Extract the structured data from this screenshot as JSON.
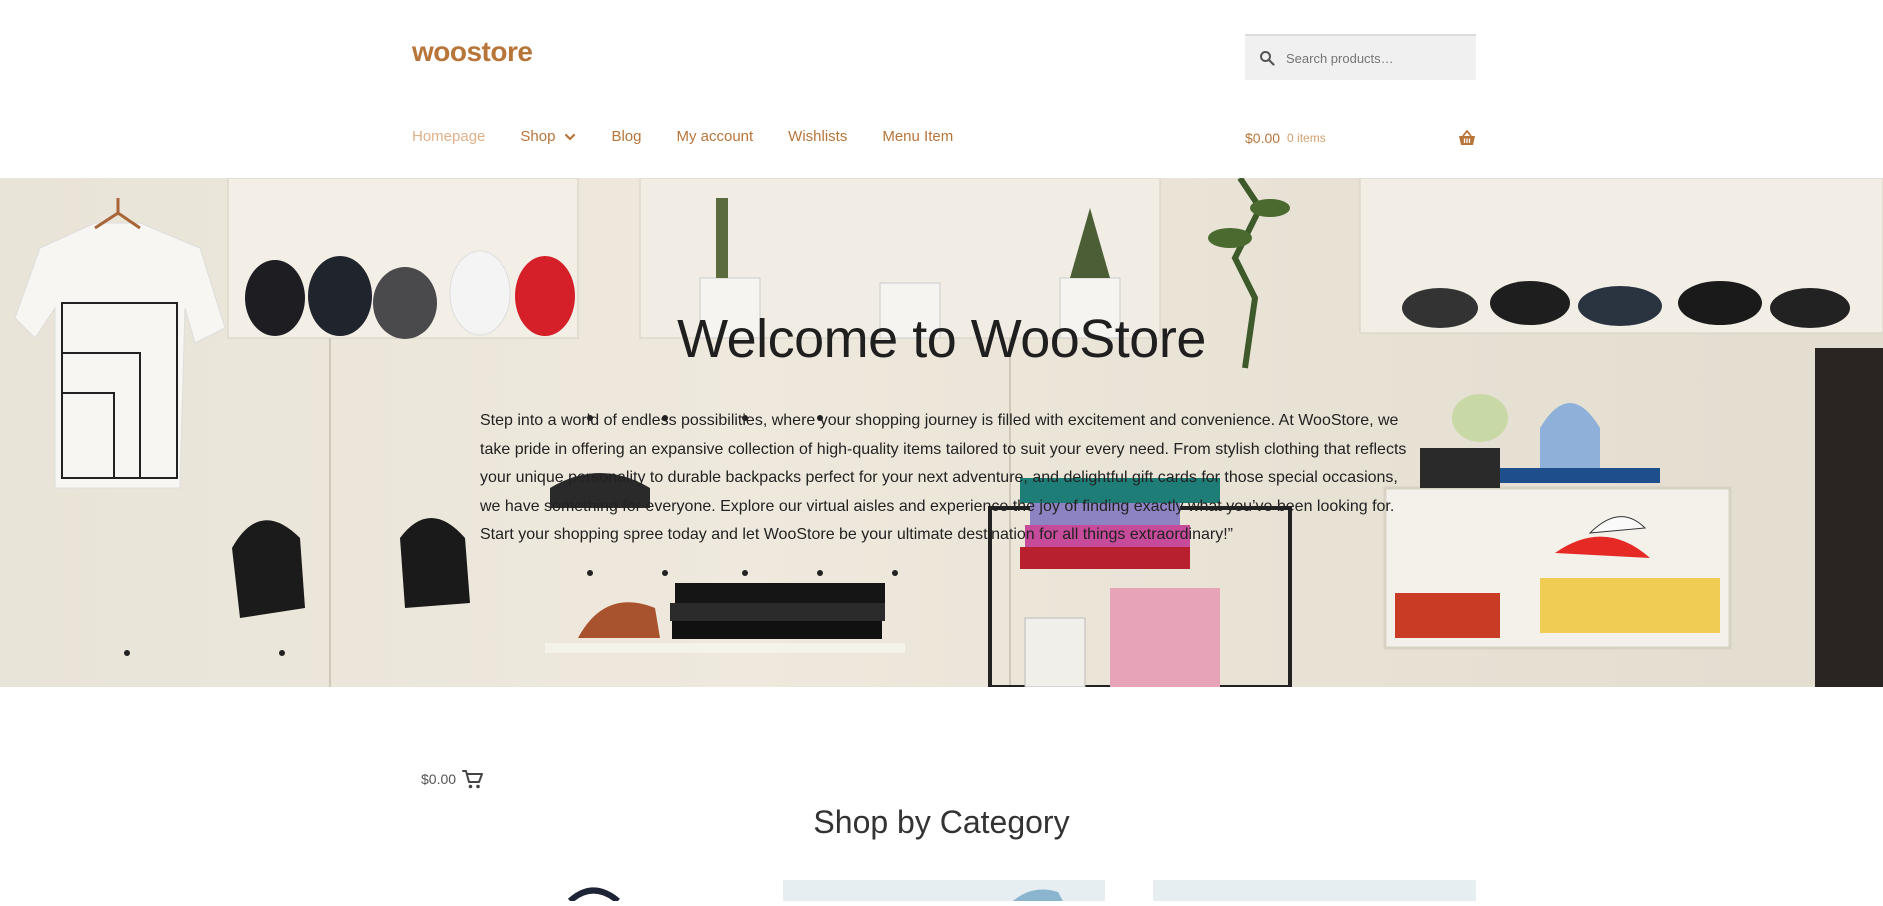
{
  "header": {
    "logo": "woostore",
    "search": {
      "placeholder": "Search products…"
    },
    "nav": [
      {
        "label": "Homepage",
        "active": true
      },
      {
        "label": "Shop",
        "has_submenu": true
      },
      {
        "label": "Blog"
      },
      {
        "label": "My account"
      },
      {
        "label": "Wishlists"
      },
      {
        "label": "Menu Item"
      }
    ],
    "cart": {
      "amount": "$0.00",
      "count": "0 items"
    }
  },
  "hero": {
    "title": "Welcome to WooStore",
    "text": "Step into a world of endless possibilities, where your shopping journey is filled with excitement and convenience. At WooStore, we take pride in offering an expansive collection of high-quality items tailored to suit your every need. From stylish clothing that reflects your unique personality to durable backpacks perfect for your next adventure, and delightful gift cards for those special occasions, we have something for everyone. Explore our virtual aisles and experience the joy of finding exactly what you’ve been looking for. Start your shopping spree today and let WooStore be your ultimate destination for all things extraordinary!”"
  },
  "mini_cart": {
    "amount": "$0.00"
  },
  "shop_section": {
    "title": "Shop by Category"
  },
  "colors": {
    "accent": "#b8753a",
    "accent_light": "#e0b089",
    "search_bg": "#f0f0f0"
  },
  "icons": [
    "search-icon",
    "chevron-down-icon",
    "basket-icon",
    "cart-icon"
  ]
}
